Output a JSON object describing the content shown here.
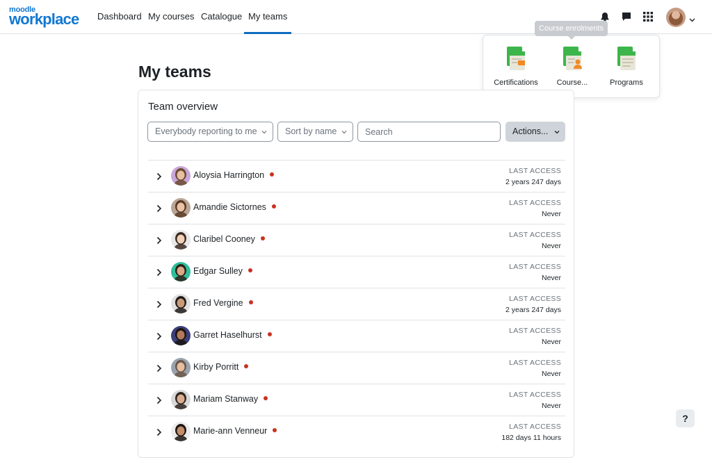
{
  "brand": {
    "small": "moodle",
    "big": "workplace"
  },
  "nav": {
    "items": [
      {
        "label": "Dashboard"
      },
      {
        "label": "My courses"
      },
      {
        "label": "Catalogue"
      },
      {
        "label": "My teams",
        "active": true
      }
    ],
    "icons": [
      "bell-icon",
      "message-icon",
      "app-grid-icon"
    ]
  },
  "launcher": {
    "tooltip": "Course enrolments",
    "apps": [
      {
        "label": "Certifications",
        "icon": "certificate-doc-icon"
      },
      {
        "label": "Course...",
        "icon": "course-enrolment-doc-icon"
      },
      {
        "label": "Programs",
        "icon": "program-doc-icon"
      }
    ]
  },
  "page": {
    "title": "My teams",
    "card_title": "Team overview",
    "filter_reporting": "Everybody reporting to me",
    "filter_sort": "Sort by name",
    "search_placeholder": "Search",
    "actions_label": "Actions..."
  },
  "team": {
    "last_access_label": "LAST ACCESS",
    "members": [
      {
        "name": "Aloysia Harrington",
        "last_access": "2 years 247 days",
        "skin": "#e7bfa3",
        "hair": "#6b4a2f",
        "bg": "#c9a6d9"
      },
      {
        "name": "Amandie Sictornes",
        "last_access": "Never",
        "skin": "#e9c3a6",
        "hair": "#5a3a25",
        "bg": "#b9a596"
      },
      {
        "name": "Claribel Cooney",
        "last_access": "Never",
        "skin": "#f0d0b8",
        "hair": "#3a2a22",
        "bg": "#e8e8e8"
      },
      {
        "name": "Edgar Sulley",
        "last_access": "Never",
        "skin": "#d9a886",
        "hair": "#2b2016",
        "bg": "#2fbf9a"
      },
      {
        "name": "Fred Vergine",
        "last_access": "2 years 247 days",
        "skin": "#c99a7a",
        "hair": "#1f1a16",
        "bg": "#e0e0e0"
      },
      {
        "name": "Garret Haselhurst",
        "last_access": "Never",
        "skin": "#b27a5a",
        "hair": "#1a1410",
        "bg": "#3b3f7a"
      },
      {
        "name": "Kirby Porritt",
        "last_access": "Never",
        "skin": "#e4bfa2",
        "hair": "#6c5848",
        "bg": "#9aa3ad"
      },
      {
        "name": "Mariam Stanway",
        "last_access": "Never",
        "skin": "#d9ad8e",
        "hair": "#2e2420",
        "bg": "#d8d8d8"
      },
      {
        "name": "Marie-ann Venneur",
        "last_access": "182 days 11 hours",
        "skin": "#c48e6a",
        "hair": "#1c1510",
        "bg": "#ececec"
      }
    ]
  },
  "help_label": "?"
}
